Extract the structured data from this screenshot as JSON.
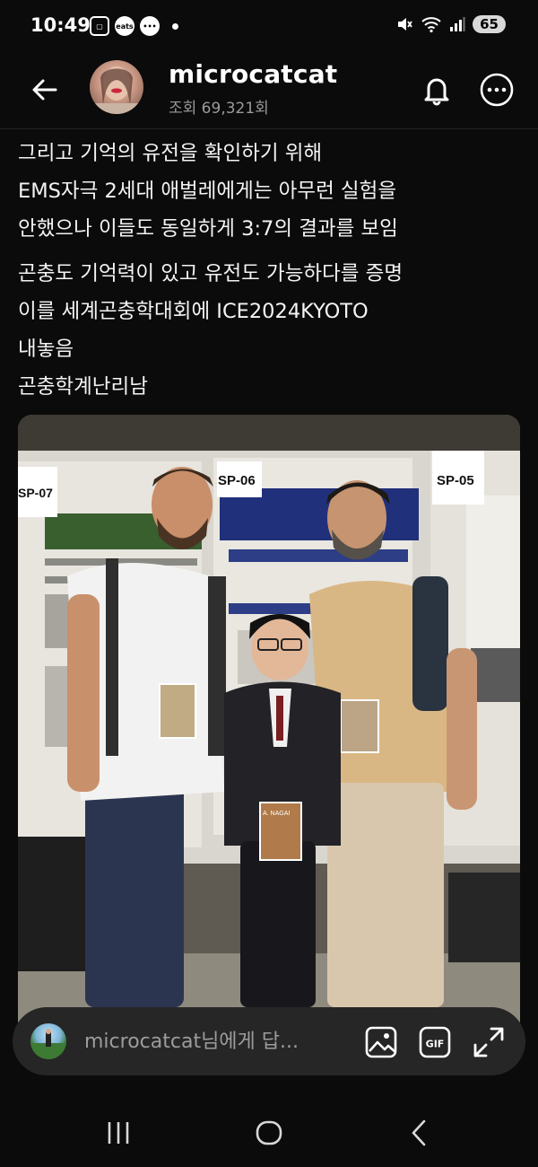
{
  "status_bar": {
    "time": "10:49",
    "notif_icons": [
      "screenshot-icon",
      "coupang-eats-icon",
      "chat-bubble-icon"
    ],
    "battery": "65"
  },
  "header": {
    "username": "microcatcat",
    "views": "조회 69,321회"
  },
  "post": {
    "paragraphs": [
      [
        "그리고  기억의 유전을 확인하기 위해",
        "EMS자극 2세대 애벌레에게는 아무런 실험을",
        "안했으나 이들도 동일하게 3:7의 결과를 보임"
      ],
      [
        "곤충도 기억력이 있고 유전도 가능하다를 증명",
        "이를 세계곤충학대회에 ICE2024KYOTO",
        "내놓음",
        "곤충학계난리남"
      ]
    ]
  },
  "photo": {
    "poster_labels": [
      "SP-07",
      "SP-06",
      "SP-05"
    ],
    "badge_name": "A. NAGAI"
  },
  "reply": {
    "placeholder": "microcatcat님에게 답..."
  },
  "icons": {
    "back": "arrow-left-icon",
    "bell": "bell-icon",
    "more": "more-horizontal-icon",
    "image": "image-icon",
    "gif": "gif-icon",
    "expand": "expand-icon"
  }
}
